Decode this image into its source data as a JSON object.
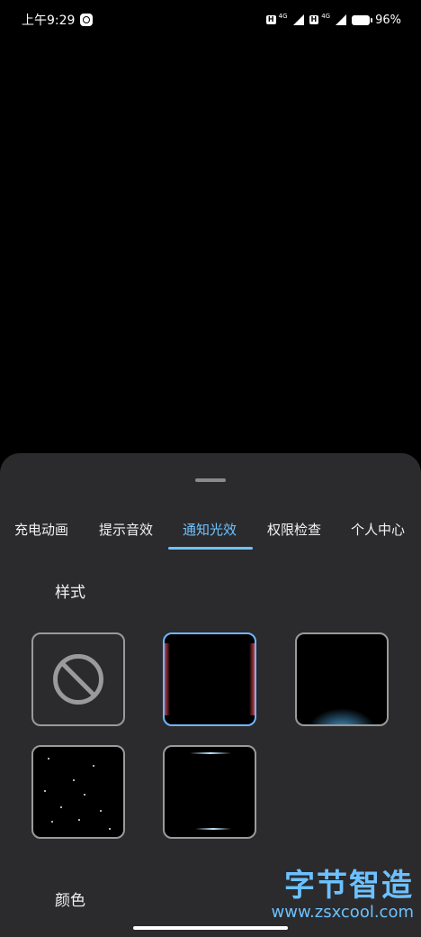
{
  "status_bar": {
    "time": "上午9:29",
    "net_label_1": "4G",
    "net_label_2": "4G",
    "battery_pct": "96%"
  },
  "tabs": [
    {
      "label": "充电动画",
      "active": false
    },
    {
      "label": "提示音效",
      "active": false
    },
    {
      "label": "通知光效",
      "active": true
    },
    {
      "label": "权限检查",
      "active": false
    },
    {
      "label": "个人中心",
      "active": false
    }
  ],
  "sections": {
    "style_title": "样式",
    "color_title": "颜色"
  },
  "styles": [
    {
      "icon": "none-icon",
      "selected": false
    },
    {
      "icon": "side-edge-glow",
      "selected": true
    },
    {
      "icon": "bottom-glow",
      "selected": false
    },
    {
      "icon": "star-particles",
      "selected": false
    },
    {
      "icon": "top-bottom-lines",
      "selected": false
    }
  ],
  "watermark": {
    "title": "字节智造",
    "url": "www.zsxcool.com"
  },
  "colors": {
    "accent": "#6fc3ff",
    "sheet_bg": "#2b2b2d",
    "screen_bg": "#000000"
  }
}
